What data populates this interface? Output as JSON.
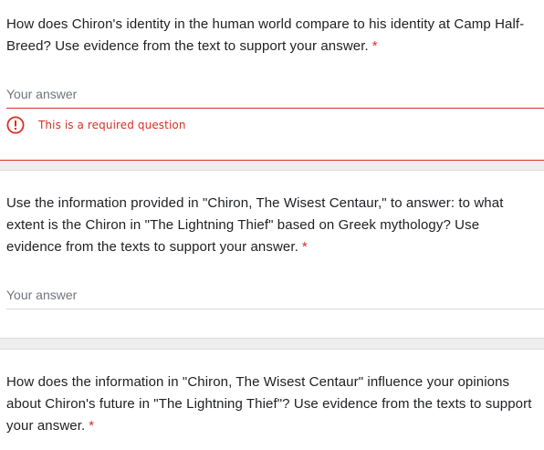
{
  "questions": [
    {
      "text": "How does Chiron's identity in the human world compare to his identity at Camp Half-Breed? Use evidence from the text to support your answer.",
      "required_marker": "*",
      "placeholder": "Your answer",
      "value": "",
      "error": "This is a required question"
    },
    {
      "text": "Use the information provided in \"Chiron, The Wisest Centaur,\" to answer: to what extent is the Chiron in \"The Lightning Thief\" based on Greek mythology? Use evidence from the texts to support your answer.",
      "required_marker": "*",
      "placeholder": "Your answer",
      "value": ""
    },
    {
      "text": "How does the information in \"Chiron, The Wisest Centaur\" influence your opinions about Chiron's future in \"The Lightning Thief\"? Use evidence from the texts to support your answer.",
      "required_marker": "*"
    }
  ],
  "colors": {
    "error": "#d93025",
    "text": "#202124",
    "placeholder": "#70757a",
    "divider": "#dadce0",
    "section_gap": "#eeeeee"
  },
  "icons": {
    "error": "error-outline-icon"
  }
}
